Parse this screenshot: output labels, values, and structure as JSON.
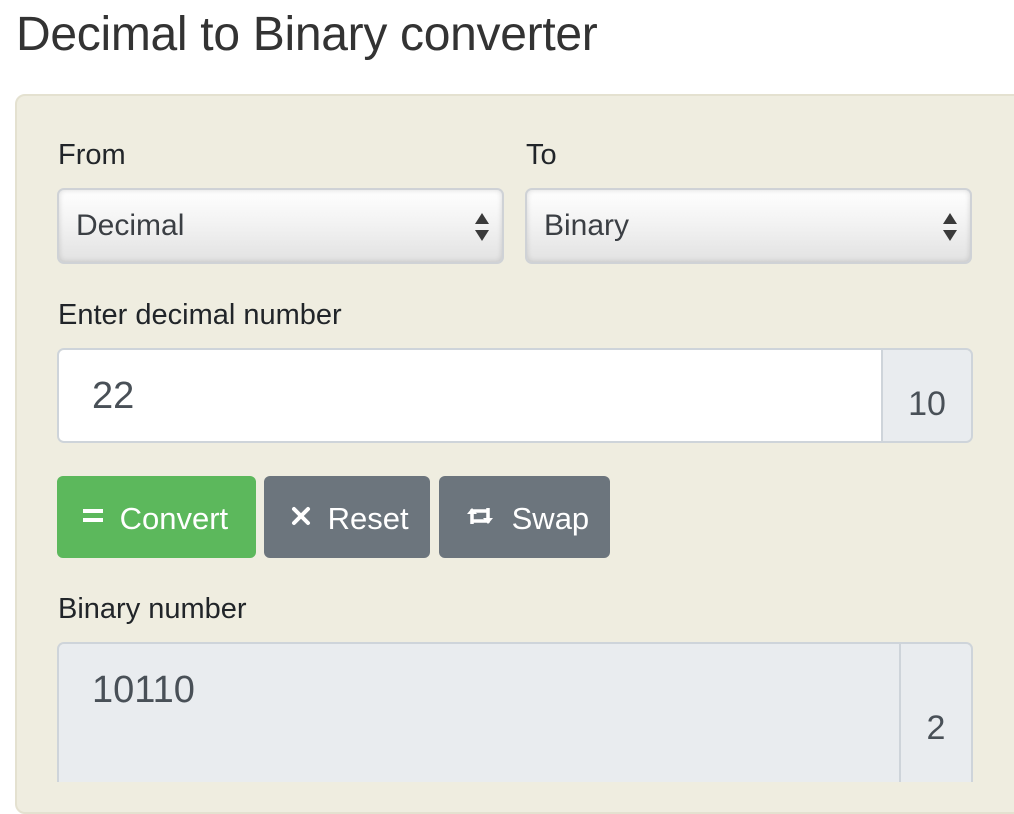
{
  "page": {
    "title": "Decimal to Binary converter"
  },
  "form": {
    "from_label": "From",
    "from_value": "Decimal",
    "to_label": "To",
    "to_value": "Binary",
    "input_label": "Enter decimal number",
    "input_value": "22",
    "input_base": "10",
    "output_label": "Binary number",
    "output_value": "10110",
    "output_base": "2"
  },
  "buttons": {
    "convert_label": "Convert",
    "convert_icon": "equals-icon",
    "reset_label": "Reset",
    "reset_icon": "close-icon",
    "swap_label": "Swap",
    "swap_icon": "swap-icon"
  },
  "colors": {
    "panel_background": "#efede0",
    "convert_button": "#5cb85c",
    "secondary_button": "#6c757d",
    "readonly_field": "#e9ecef"
  }
}
